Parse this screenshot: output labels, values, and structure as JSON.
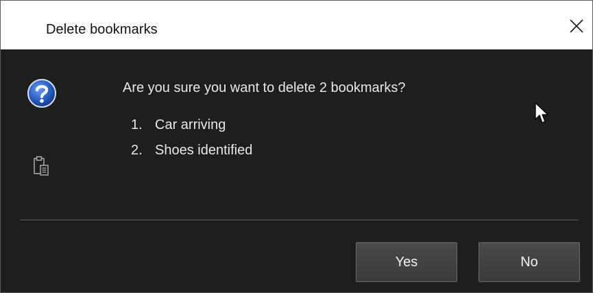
{
  "dialog": {
    "title": "Delete bookmarks",
    "message": "Are you sure you want to delete 2 bookmarks?",
    "items": [
      {
        "number": "1.",
        "label": "Car arriving"
      },
      {
        "number": "2.",
        "label": "Shoes identified"
      }
    ],
    "buttons": {
      "yes_label": "Yes",
      "no_label": "No"
    },
    "icons": {
      "close": "close-icon",
      "help": "question-icon",
      "copy": "clipboard-icon",
      "cursor": "mouse-pointer-icon"
    },
    "colors": {
      "background": "#1e1e1e",
      "titlebar": "#ffffff",
      "help_icon_blue": "#2a5fc4",
      "button": "#424242"
    }
  }
}
